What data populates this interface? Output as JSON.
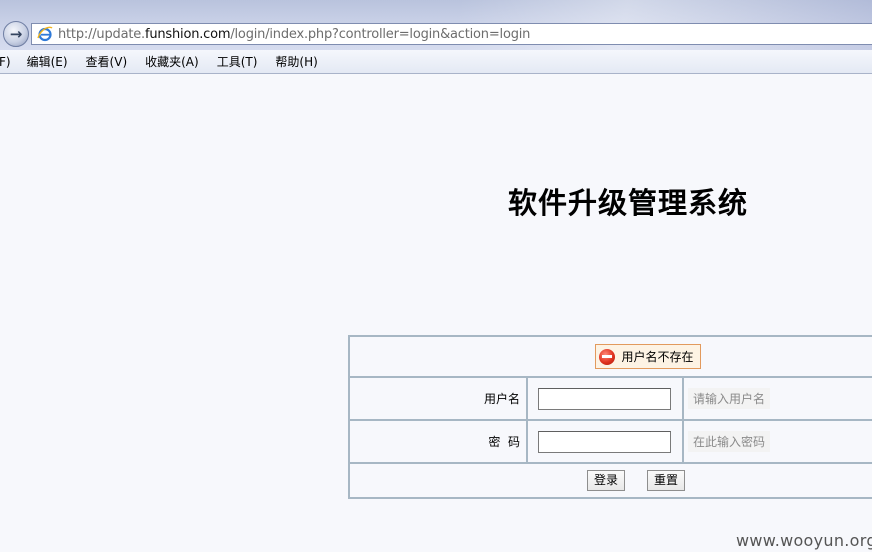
{
  "browser": {
    "url_prefix": "http://update.",
    "url_domain": "funshion.com",
    "url_path": "/login/index.php?controller=login&action=login"
  },
  "menu": [
    {
      "label": "F)"
    },
    {
      "label": "编辑(E)"
    },
    {
      "label": "查看(V)"
    },
    {
      "label": "收藏夹(A)"
    },
    {
      "label": "工具(T)"
    },
    {
      "label": "帮助(H)"
    }
  ],
  "page": {
    "title": "软件升级管理系统",
    "error_message": "用户名不存在",
    "username_label": "用户名",
    "username_value": "",
    "username_hint": "请输入用户名",
    "password_label": "密  码",
    "password_value": "",
    "password_hint": "在此输入密码",
    "login_button": "登录",
    "reset_button": "重置"
  },
  "watermark": "www.wooyun.org",
  "colors": {
    "table_border": "#a7b7c4",
    "error_border": "#e29a5d",
    "error_icon": "#e0321f"
  }
}
